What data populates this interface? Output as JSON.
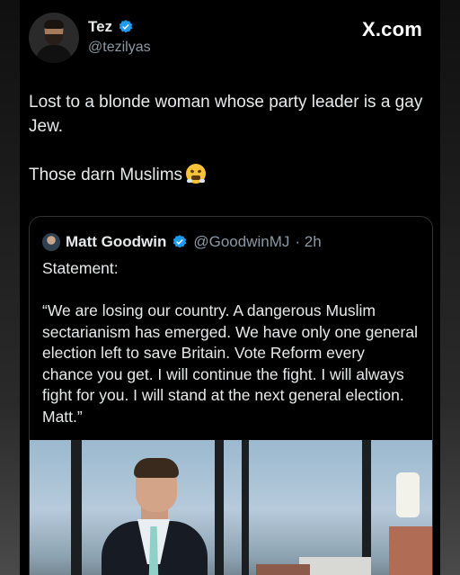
{
  "author": {
    "name": "Tez",
    "handle": "@tezilyas"
  },
  "brand": "X.com",
  "tweet": {
    "line1": "Lost to a blonde woman whose party leader is a gay Jew.",
    "line2": "Those darn Muslims",
    "emoji": "face-with-steam-from-nose"
  },
  "quoted": {
    "name": "Matt Goodwin",
    "handle": "@GoodwinMJ",
    "time": "· 2h",
    "text1": "Statement:",
    "text2": "“We are losing our country. A dangerous Muslim sectarianism has emerged. We have only one general election left to save Britain. Vote Reform every chance you get. I will continue the fight. I will always fight for you. I will stand at the next general election. Matt.”"
  },
  "colors": {
    "background": "#000000",
    "text": "#e7e9ea",
    "muted": "#8b98a5",
    "verified": "#1d9bf0",
    "border": "#2f3336"
  }
}
